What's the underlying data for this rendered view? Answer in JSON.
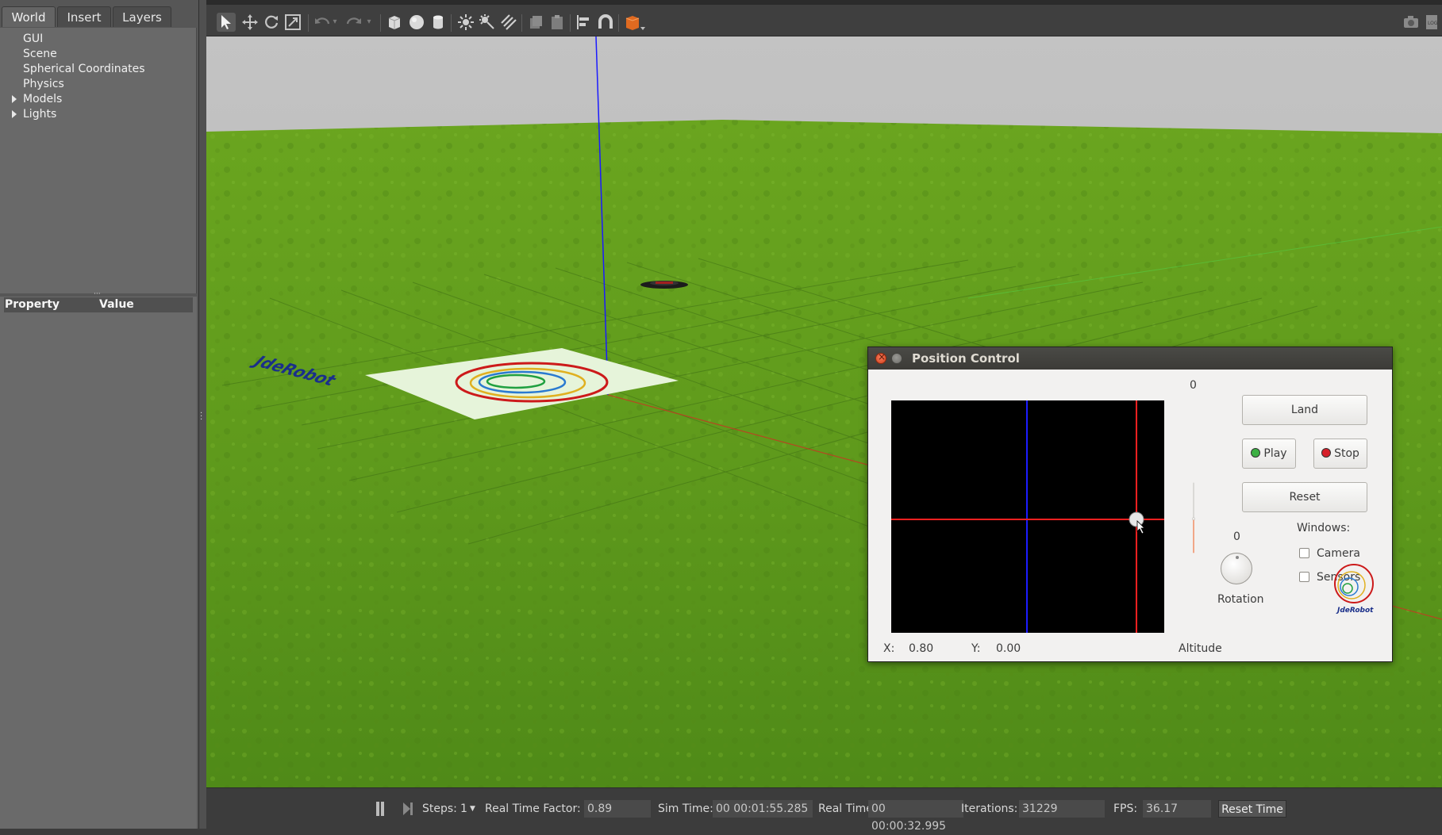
{
  "left_panel": {
    "tabs": [
      {
        "label": "World"
      },
      {
        "label": "Insert"
      },
      {
        "label": "Layers"
      }
    ],
    "tree_items": [
      {
        "label": "GUI",
        "expandable": false
      },
      {
        "label": "Scene",
        "expandable": false
      },
      {
        "label": "Spherical Coordinates",
        "expandable": false
      },
      {
        "label": "Physics",
        "expandable": false
      },
      {
        "label": "Models",
        "expandable": true
      },
      {
        "label": "Lights",
        "expandable": true
      }
    ],
    "property_header": {
      "property": "Property",
      "value": "Value"
    }
  },
  "toolbar": {
    "icons": [
      "select-icon",
      "translate-icon",
      "rotate-icon",
      "scale-icon",
      "undo-icon",
      "undo-history-icon",
      "redo-icon",
      "redo-history-icon",
      "box-icon",
      "sphere-icon",
      "cylinder-icon",
      "point-light-icon",
      "spot-light-icon",
      "directional-light-icon",
      "copy-icon",
      "paste-icon",
      "align-icon",
      "snap-icon",
      "change-view-icon",
      "screenshot-icon",
      "log-icon"
    ]
  },
  "viewport": {
    "mat_text": "JdeRobot",
    "colors": {
      "grass": "#5e9a1e",
      "sky": "#b8b8b8",
      "z_axis": "#1a1aff",
      "x_axis": "#cc3322"
    }
  },
  "status_bar": {
    "steps_label": "Steps:",
    "steps_value": "1",
    "rtf_label": "Real Time Factor:",
    "rtf_value": "0.89",
    "sim_time_label": "Sim Time:",
    "sim_time_value": "00 00:01:55.285",
    "real_time_label": "Real Time:",
    "real_time_value": "00 00:00:32.995",
    "iterations_label": "Iterations:",
    "iterations_value": "31229",
    "fps_label": "FPS:",
    "fps_value": "36.17",
    "reset_time_label": "Reset Time"
  },
  "position_control": {
    "title": "Position Control",
    "x_label": "X:",
    "x_value": "0.80",
    "y_label": "Y:",
    "y_value": "0.00",
    "altitude_value": "0",
    "altitude_label": "Altitude",
    "rotation_value": "0",
    "rotation_label": "Rotation",
    "land_label": "Land",
    "play_label": "Play",
    "stop_label": "Stop",
    "reset_label": "Reset",
    "windows_label": "Windows:",
    "camera_label": "Camera",
    "sensors_label": "Sensors",
    "camera_checked": false,
    "sensors_checked": false,
    "logo_text": "JdeRobot",
    "colors": {
      "play_led": "#3cb043",
      "stop_led": "#d6202a",
      "pad_bg": "#000000",
      "pad_red": "#ff2020",
      "pad_blue": "#1c1cff",
      "slider_fill": "#f0703a"
    }
  }
}
